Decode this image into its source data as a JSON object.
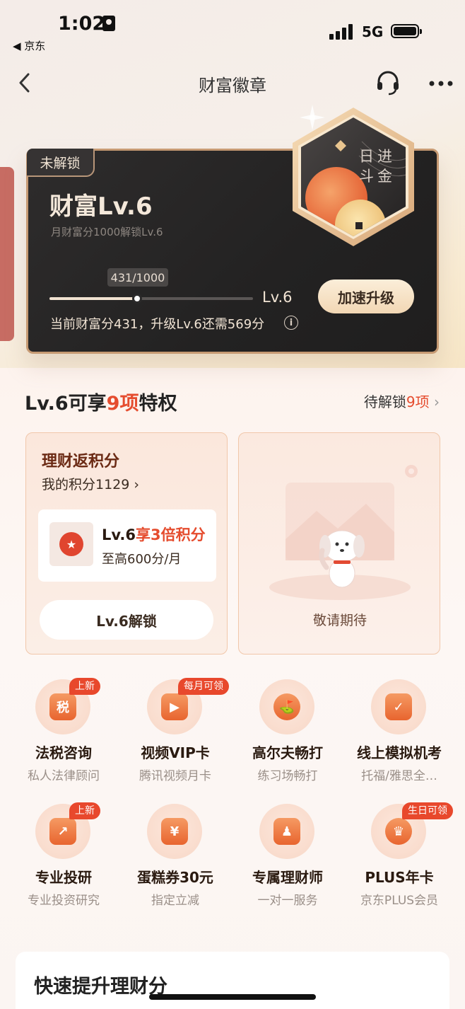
{
  "status_bar": {
    "time": "1:02",
    "back_app": "◀ 京东",
    "network": "5G"
  },
  "nav": {
    "title": "财富徽章",
    "back_icon": "chevron-left-icon",
    "service_icon": "headset-icon",
    "more_icon": "more-dots-icon"
  },
  "level_card": {
    "lock_tag": "未解锁",
    "title": "财富Lv.6",
    "subtitle": "月财富分1000解锁Lv.6",
    "progress_label": "431/1000",
    "progress_value": 431,
    "progress_max": 1000,
    "target_level": "Lv.6",
    "boost_button": "加速升级",
    "description": "当前财富分431，升级Lv.6还需569分",
    "info_icon": "info-icon",
    "badge_text": "日进斗金"
  },
  "privileges": {
    "title_prefix": "Lv.6可享",
    "title_count": "9项",
    "title_suffix": "特权",
    "more_prefix": "待解锁",
    "more_count": "9项",
    "more_icon": "chevron-right-icon"
  },
  "points_card": {
    "title": "理财返积分",
    "points": "我的积分1129 ›",
    "inner_prefix": "Lv.6",
    "inner_highlight": "享3倍积分",
    "inner_sub": "至高600分/月",
    "button": "Lv.6解锁"
  },
  "coming_card": {
    "text": "敬请期待"
  },
  "benefits": [
    {
      "name": "法税咨询",
      "sub": "私人法律顾问",
      "tag": "上新",
      "glyph": "税",
      "icon": "tax-icon"
    },
    {
      "name": "视频VIP卡",
      "sub": "腾讯视频月卡",
      "tag": "每月可领",
      "glyph": "▶",
      "icon": "video-play-icon"
    },
    {
      "name": "高尔夫畅打",
      "sub": "练习场畅打",
      "tag": "",
      "glyph": "⛳",
      "icon": "golf-icon"
    },
    {
      "name": "线上模拟机考",
      "sub": "托福/雅思全…",
      "tag": "",
      "glyph": "✓",
      "icon": "monitor-check-icon"
    },
    {
      "name": "专业投研",
      "sub": "专业投资研究",
      "tag": "上新",
      "glyph": "↗",
      "icon": "chart-trend-icon"
    },
    {
      "name": "蛋糕券30元",
      "sub": "指定立减",
      "tag": "",
      "glyph": "¥",
      "icon": "coupon-icon"
    },
    {
      "name": "专属理财师",
      "sub": "一对一服务",
      "tag": "",
      "glyph": "♟",
      "icon": "advisor-icon"
    },
    {
      "name": "PLUS年卡",
      "sub": "京东PLUS会员",
      "tag": "生日可领",
      "glyph": "♛",
      "icon": "crown-icon"
    }
  ],
  "bottom": {
    "title": "快速提升理财分"
  },
  "colors": {
    "accent": "#e54c2e",
    "card_dark": "#232222",
    "gold": "#c69a73"
  }
}
